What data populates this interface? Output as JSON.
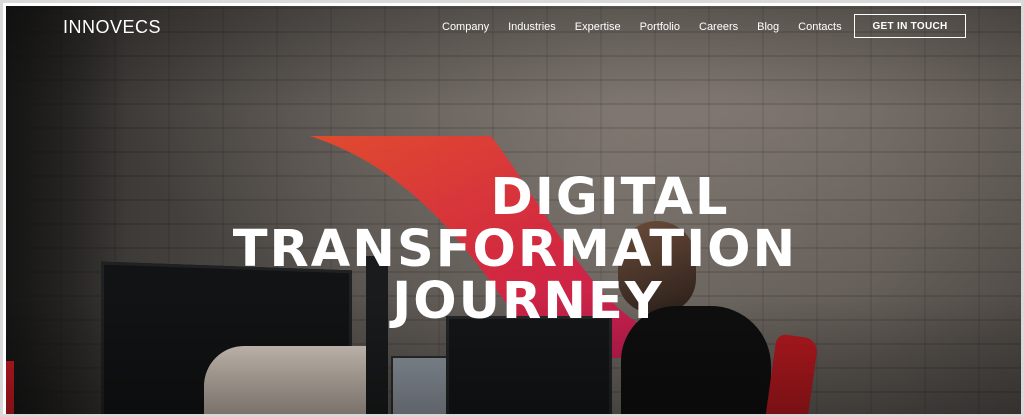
{
  "header": {
    "logo": "INNOVECS",
    "nav": [
      "Company",
      "Industries",
      "Expertise",
      "Portfolio",
      "Careers",
      "Blog",
      "Contacts"
    ],
    "cta_label": "GET IN TOUCH"
  },
  "hero": {
    "headline_line1": "DIGITAL",
    "headline_line2": "TRANSFORMATION",
    "headline_line3": "JOURNEY"
  },
  "colors": {
    "ribbon_start": "#e8452a",
    "ribbon_end": "#d0154e",
    "chair": "#b5191f"
  },
  "icons": [
    "brand-ribbon-graphic"
  ]
}
